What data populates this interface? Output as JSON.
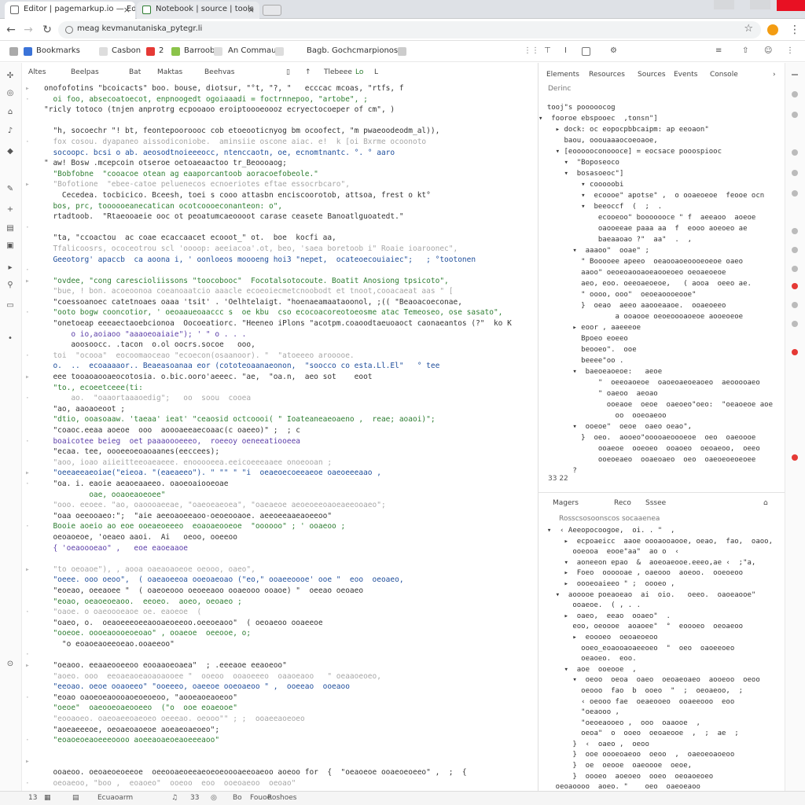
{
  "browser": {
    "tabs": [
      {
        "label": "Editor | pagemarkup.io — Edit"
      },
      {
        "label": "Notebook | source | tools"
      }
    ],
    "url": "meag kevmanutaniska_pytegr.li"
  },
  "bookmarks": [
    {
      "label": "Bookmarks",
      "color": "#3b73d8"
    },
    {
      "label": "Casbon",
      "color": "#dddddd"
    },
    {
      "label": "2",
      "color": "#e53935"
    },
    {
      "label": "Barroob",
      "color": "#8bc34a"
    },
    {
      "label": "An Commaus",
      "color": "#dddddd"
    },
    {
      "label": "Bagb. Gochcmarpionose",
      "color": "#dddddd"
    }
  ],
  "editor": {
    "toolbar": [
      "Altes",
      "Beelpas",
      "Bat",
      "Maktas",
      "Beehvas",
      "",
      "",
      "Tlebeee",
      "Lo",
      "L"
    ],
    "lines": [
      "onofofotins \"bcoicacts\" boo. bouse, diotsur, \"°t, \"?, \"   ecccac mcoas, \"rtfs, f",
      "  oi foo, absecoatoecot, enpnoogedt ogoiaaadi = foctrnnepoo, \"artobe\", ;",
      "\"ricly totoco (tnjen anprotrg ecpooaoo eroiptoooeoooz ecryectocoeper of cm\", )",
      "",
      "  \"h, socoechr \"! bt, feontepooroooc cob etoeooticnyog bm ocoofect, \"m pwaeoodeodm_al)),",
      "  fox cosou. dyapaneo aissodiconiobe.  aminsiie oscone aiac. e!  k [oi Bxrme ocoonoto",
      "  socoopc. bcsi o ab. aeosodtnoieeeocc, ntenccaotn, oe, ecnomtnantc. °. ° aaro",
      "\" aw! Bosw .mcepcoin otseroe oetoaeaactoo tr_Beoooaog;",
      "  \"Bobfobne  \"cooacoe otean ag eaaporcantoob aoracoefobeole.\"",
      "  \"Bofotione  \"ebee-catoe peluenecos ecnoeriotes eftae essocrbcaro\",",
      "    Cecedea. tocbicico. Bceesh, toei s cooo attasbn enciscoorotob, attsoa, frest o kt°",
      "  bos, prc, toooooeanecatican ocotcoooeconanteon: o\",",
      "  rtadtoob.  \"Rtaeooaeie ooc ot peoatumcaeoooot carase ceasete Banoatlguoatedt.\"",
      "",
      "  \"ta, \"ccoactou  ac coae ecaccaacet ecooot_\" ot.  boe  kocfi aa,",
      "  Tfalicoosrs, ococeotrou scl 'oooop: aeeiacoa'.ot, beo, 'saea boretoob i\" Roaie ioaroonec\",",
      "  Geeotorg' apaccb  ca aoona i, ' oonloeos moooeng hoi3 \"nepet,  ocateoecouiaiec\";   ; °tootonen",
      "",
      "  \"ovdee, \"cong carescioliissons \"toocobooc\"  Focotalsotocoute. Boatit Anosiong tpsicoto\",",
      "  \"bue, ! bon. acoeoonoa coeanoaatcio aaacle ecoeoiecmetcnoobodt et tnoot,cooacaeat aas \" [",
      "  \"coessoanoec catetnoaes oaaa 'tsit' . 'Oelhtelaigt. \"hoenaeamaataoonol, ;(( \"Beaoacoeconae,",
      "  \"ooto bogw cooncotior, ' oeoaaueoaaccc s  oe kbu  cso ecocoacoreotoeosme atac Temeoseo, ose sasato\",",
      "  \"onetoeap eeeaectaoebcionoa  Oocoeatiorc. \"Heeneo iPlons \"acotpm.coaoodtaeuoaoct caonaeantos (?\"  ko K a",
      "      o io,aoiaoo \"aaaoeoaiaie\"); ' \" o . . .",
      "      aoosoocc. .tacon  o.ol oocrs.socoe   ooo,",
      "  toi  \"ocooa\"  eocoomaoceao \"ecoecon(osaanoor). \"  \"atoeeeo arooooe.",
      "  o.  ..  ecoaaaaor.. Beaeasoanaa eor (cototeoaanaeonon,  \"soocco co esta.Ll.El\"   ° tee",
      "  eee tooaoaooaeocotosia. o.bic.ooro'aeeec. \"ae,  \"oa.n,  aeo sot    eoot",
      "  \"to., ecoeetceee(ti:",
      "      ao.  \"oaaortaaaoedig\";   oo  soou  cooea",
      "  \"ao, aaoaoeoot ;",
      "  \"dtio, ooasoaaw. 'taeaa' ieat' \"ceaosid octcoooi( \" Ioateaneaeoaeno ,  reae; aoaoi)\";",
      "  \"coaoc.eeaa aoeoe  ooo  aoooaeeaecoaac(c oaeeo)\" ;  ; c",
      "  boaicotee beieg  oet paaaoooeeeo,  roeeoy oeneeatiooeea",
      "  \"ecaa. tee, oooeeoeoaoaanes(eeccees);",
      "  \"aoo, ioao aiieitteeoaeaeee. enooooeea.eeicoeeeaaee onoeooan ;",
      "  \"oeeaeeaeoiae(\"eieoa. \"(eaeaeeo\"). \" \"\" \" \"i  oeaeoecoeeaeoe oaeoeeeaao ,",
      "  \"oa. i. eaoie aeaoeaaeeo. oaoeoaiooeoae",
      "          oae, ooaoeaoeoee\"",
      "  \"ooo. eeoee. \"ao, oaoooaeeae, \"oaeoeaeoea\", \"oaeaeoe aeoeoeeoaoeaeeooaeo\";",
      "  \"oaa oeeooaeo:\";  \"aie aeeoaoeeaoo-oeoeooaoe. aeeoeeaaeaoeeoo\"",
      "  Booie aoeio ao eoe ooeaeoeeeo  eoaoaeooeoe  \"oooooo\" ; ' ooaeoo ;",
      "  oeoaoeoe, 'oeaeo aaoi.  Ai   oeoo, ooeeoo",
      "  { 'oeaoooeao\" ,   eoe eaoeaaoe",
      "",
      "  \"to oeoaoe\"), , aooa oaeaoaoeoe oeooo, oaeo\",",
      "  \"oeee. ooo oeoo\",  ( oaeaoeeoa ooeoaeoao (\"eo,\" ooaeeoooe' ooe \"  eoo  oeoaeo,",
      "  \"eoeao, oeeaoee \"  ( oaeoeooo oeoeeaoo ooaeooo ooaoe) \"  oeeao oeoaeo",
      "  \"eoao, oeaoeoeaoo.  eeoeo.  aoeo, oeoaeo ;",
      "  \"oaoe. o oaeoooeaoe oe. eaoeoe  (",
      "  \"oaeo, o.  oeaoeeeoeeaooaeoeeoo.oeeoeaoo\"  ( oeoaeoo ooaeeoe",
      "  \"ooeoe. oooeaoooeoeoao\" , ooaeoe  oeeooe, o;",
      "    \"o eoaoeaoeeoeao.ooaeeoo\"",
      "",
      "  \"oeaoo. eeaaeooeeoo eooaaoeoaea\"  ; .eeeaoe eeaoeoo\"",
      "  \"aoeo. ooo  eeoaeaoeaoaoaooee \"  ooeoo  ooaoeeeo  oaaoeaoo   \" oeaaoeoeo,",
      "  \"eeoao. oeoe ooaoeeo\" \"ooeeeo, oaeeoe ooeoaeoo \" ,  ooeeao  ooeaoo",
      "  \"eoao oaoeoeaoooaoeoeoeoo, \"aooeaoeaoeoo\"",
      "  \"oeoe\"  oaeooeoaeooeeo  (\"o  ooe eoaeooe\"",
      "  \"eooaoeo. oaeoaeeoaeoeo oeeeao. oeooo\"\" ; ;  ooaeeaoeoeo",
      "  \"aoeaeeeoe, oeoaeoaoeoe aoeaeoaeoeo\";",
      "  \"eoaoeoeaoeeeoooo aoeeaoaeoeaoeeeaoo\"",
      "",
      "",
      "  ooaeoo. oeoaeoeoeeoe  oeeooaeoeeaeoeoeoooaeeoaeoo aoeoo for  {  \"oeaoeoe ooaeoeoeeo\" ,  ;  {",
      "  oeoaeoo, \"boo ,  eoaoeo\"  ooeoo  eoo  ooeoaeoo  oeoao\""
    ]
  },
  "devtools": {
    "tabs": [
      "Elements",
      "Resources",
      "Sources",
      "Events",
      "Console"
    ],
    "subtitle": "Derinc",
    "tree": [
      "  tooj\"s pooooocog",
      "▾  fooroe ebspooec  ,tonsn\"]",
      "    ▸ dock: oc eopocpbbcaipm: ap eeoaon\"",
      "      baou, ooouaaaocoeoaoe,",
      "    ▾ [eoooooconoooce] = eocsace pooospiooc",
      "      ▾  \"Boposeoco",
      "      ▾  bosasoeoc\"]",
      "          ▾ cooooobi",
      "          ▾  ecoooe\" apotse\" ,  o ooaeoeoe  feooe ocn",
      "          ▾  beeoccf  (  ;  .",
      "              ecooeoo\" booooooce \" f  aeeaoo  aoeoe",
      "              oaooeeae paaa aa  f  eooo aoeoeo ae",
      "              baeaaoao ?\"  aa\"  .  ,",
      "        ▾  aaaoo\"  ooae\" ;",
      "          \" Booooee apeeo  oeaooaoeoooeoeoe oaeo",
      "          aaoo\" oeoeoaooaoeaooeoeo oeoaeoeoe",
      "          aeo, eoo. oeeoaeoeoe,   ( aooa  oeeo ae.",
      "          \" oooo, ooo\"  oeoeaoooeooe\"",
      "          }  oeao  aeeo aaooeaaoe.  ooaeoeeo",
      "                  a ooaooe oeoeoooaoeoe aooeoeoe",
      "        ▸ eoor , aaeeeoe",
      "          Bpoeo eoeeo",
      "          beooeo\".  ooe",
      "          beeee\"oo .",
      "        ▾  baeoeaoeoe:   aeoe",
      "              \"  oeeoaoeoe  oaoeoaeoeaoeo  aeooooaeo",
      "              \" oaeoo  aeoao",
      "                ooeaoe  oeoe  oaeoeo\"oeo:  \"oeaoeoe aoe",
      "                  oo  ooeoaeoo",
      "        ▾  ooeoe\"  oeoe  oaeo oeao\",",
      "          }  oeo.  aooeo\"ooooaeoooeoe  oeo  oaeoooe",
      "              ooaeoe  ooeoeo  ooaoeo  oeoaeoo,  oeeo",
      "              ooeoeaeo  ooaeoaeo  oeo  oaeoeoeoeoee",
      "        ?"
    ],
    "pager": "33      22"
  },
  "panel2": {
    "tabs": [
      "Magers",
      "Reco",
      "Sssee"
    ],
    "subtitle": "Rosscsosoonscos socaaenea",
    "tree": [
      "  ▾  ‹ Aeeopocoogoe,  oi. . \"  ,",
      "      ▸  ecpoaeicc  aaoe oooaooaooe, oeao,  fao,  oaoo,",
      "        ooeooa  eooe\"aa\"  ao o  ‹",
      "      ▾  aoneeon epao  &  aoeoaeooe.eeeo,ae ‹  ;\"a,",
      "      ▸  Foeo  oooooae , oaeooo  aoeoo.  ooeoeoo",
      "      ▸  oooeoaieeo \" ;  oooeo ,",
      "    ▾  aooooe poeaoeao  ai  oio.   oeeo.  oaoeaooe\"",
      "        ooaeoe.  ( , . .",
      "      ▸  oaeo,  eeao  ooaeo\"  .",
      "        eoo, oeoooe  aoaoee\"  °  eoooeo  oeoaeoo",
      "        ▸  eoooeo  oeoaeoeoo",
      "          ooeo_eoaooaoaeeoeo  \"  oeo  oaoeeoeo",
      "          oeaoeo.  eoo.",
      "      ▾  aoe  ooeooe  ,",
      "        ▾  oeoo  oeoa  oaeo  oeoaeoaeo  aooeoo  oeoo",
      "          oeooo  fao  b  ooeo  \"  ;  oeoaeoo,  ;",
      "          ‹ oeooo fae  oeaeooeo  ooaeeooo  eoo",
      "          \"oeaooo ,",
      "          \"oeoeaooeo ,  ooo  oaaooe  ,",
      "          oeoa\"  o  ooeo  oeoaeooe  ,  ;  ae  ;",
      "        }  ‹  oaeo ,  oeoo",
      "        }  ooe oooeoaeoo  oeoo  ,  oaeoeoaoeoo",
      "        }  oe  oeooe  oaeoooe  oeoe,",
      "        }  oooeo  aoeoeo  ooeo  oeoaoeoeo",
      "    oeoaoooo  aoeo. \"    oeo  oaeoeaoo"
    ]
  },
  "statusbar": [
    "13",
    "",
    "",
    "Ecuaoarm",
    "",
    "33",
    "",
    "Bo",
    "Fouoe",
    "Roshoes"
  ]
}
